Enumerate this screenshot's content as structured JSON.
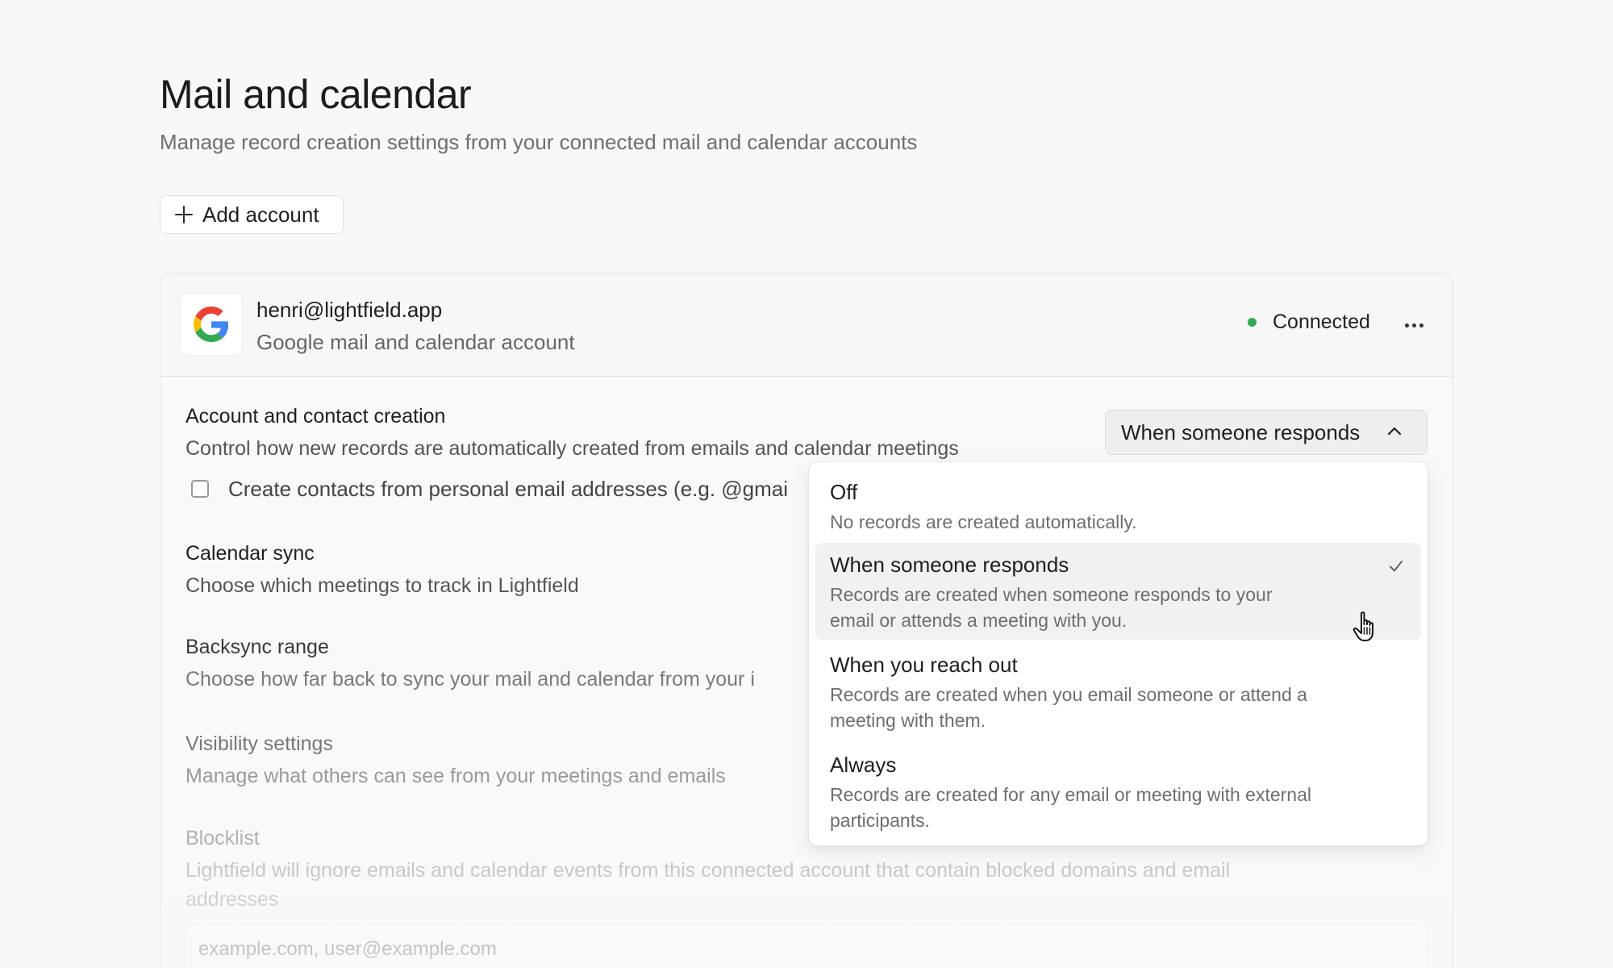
{
  "page": {
    "title": "Mail and calendar",
    "subtitle": "Manage record creation settings from your connected mail and calendar accounts",
    "add_account_label": "Add account"
  },
  "account": {
    "email": "henri@lightfield.app",
    "type": "Google mail and calendar account",
    "status": "Connected",
    "status_color": "#34a853",
    "provider_icon": "google-icon"
  },
  "sections": {
    "account_creation": {
      "title": "Account and contact creation",
      "description": "Control how new records are automatically created from emails and calendar meetings",
      "checkbox_label": "Create contacts from personal email addresses (e.g. @gmai",
      "checkbox_checked": false,
      "select_value": "When someone responds"
    },
    "calendar_sync": {
      "title": "Calendar sync",
      "description": "Choose which meetings to track in Lightfield"
    },
    "backsync": {
      "title": "Backsync range",
      "description": "Choose how far back to sync your mail and calendar from your i"
    },
    "visibility": {
      "title": "Visibility settings",
      "description": "Manage what others can see from your meetings and emails"
    },
    "blocklist": {
      "title": "Blocklist",
      "description_line1": "Lightfield will ignore emails and calendar events from this connected account that contain blocked domains and email",
      "description_line2": "addresses",
      "input_placeholder": "example.com, user@example.com"
    }
  },
  "dropdown": {
    "options": [
      {
        "label": "Off",
        "desc_line1": "No records are created automatically.",
        "desc_line2": ""
      },
      {
        "label": "When someone responds",
        "desc_line1": "Records are created when someone responds to your",
        "desc_line2": "email or attends a meeting with you.",
        "selected": true
      },
      {
        "label": "When you reach out",
        "desc_line1": "Records are created when you email someone or attend a",
        "desc_line2": "meeting with them."
      },
      {
        "label": "Always",
        "desc_line1": "Records are created for any email or meeting with external",
        "desc_line2": "participants."
      }
    ]
  }
}
